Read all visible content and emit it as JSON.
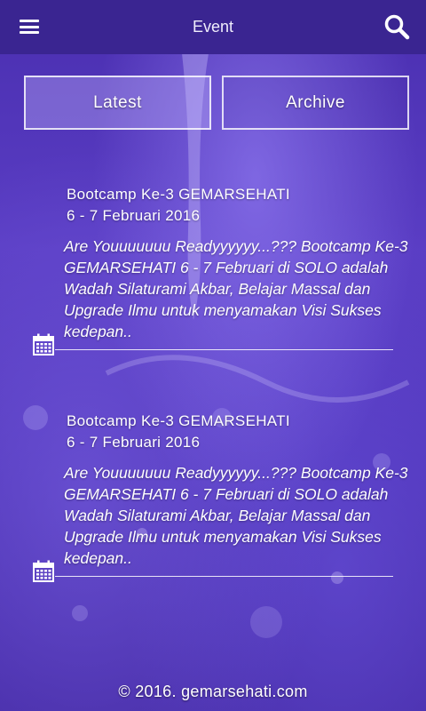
{
  "header": {
    "title": "Event",
    "menu_icon": "hamburger-menu-icon",
    "search_icon": "search-icon"
  },
  "tabs": [
    {
      "label": "Latest",
      "active": true
    },
    {
      "label": "Archive",
      "active": false
    }
  ],
  "events": [
    {
      "title": "Bootcamp Ke-3 GEMARSEHATI",
      "date": "6 - 7 Februari 2016",
      "description": "Are Youuuuuuu Readyyyyyy...??? Bootcamp Ke-3 GEMARSEHATI 6 - 7 Februari di SOLO adalah Wadah Silaturami Akbar, Belajar Massal dan Upgrade Ilmu untuk menyamakan Visi Sukses kedepan..",
      "icon": "calendar-icon"
    },
    {
      "title": "Bootcamp Ke-3 GEMARSEHATI",
      "date": "6 - 7 Februari 2016",
      "description": "Are Youuuuuuu Readyyyyyy...??? Bootcamp Ke-3 GEMARSEHATI 6 - 7 Februari di SOLO adalah Wadah Silaturami Akbar, Belajar Massal dan Upgrade Ilmu untuk menyamakan Visi Sukses kedepan..",
      "icon": "calendar-icon"
    }
  ],
  "footer": {
    "text": "© 2016. gemarsehati.com"
  },
  "colors": {
    "header_bg": "#3a2591",
    "background": "#5a3dc4",
    "text": "#ffffff"
  }
}
